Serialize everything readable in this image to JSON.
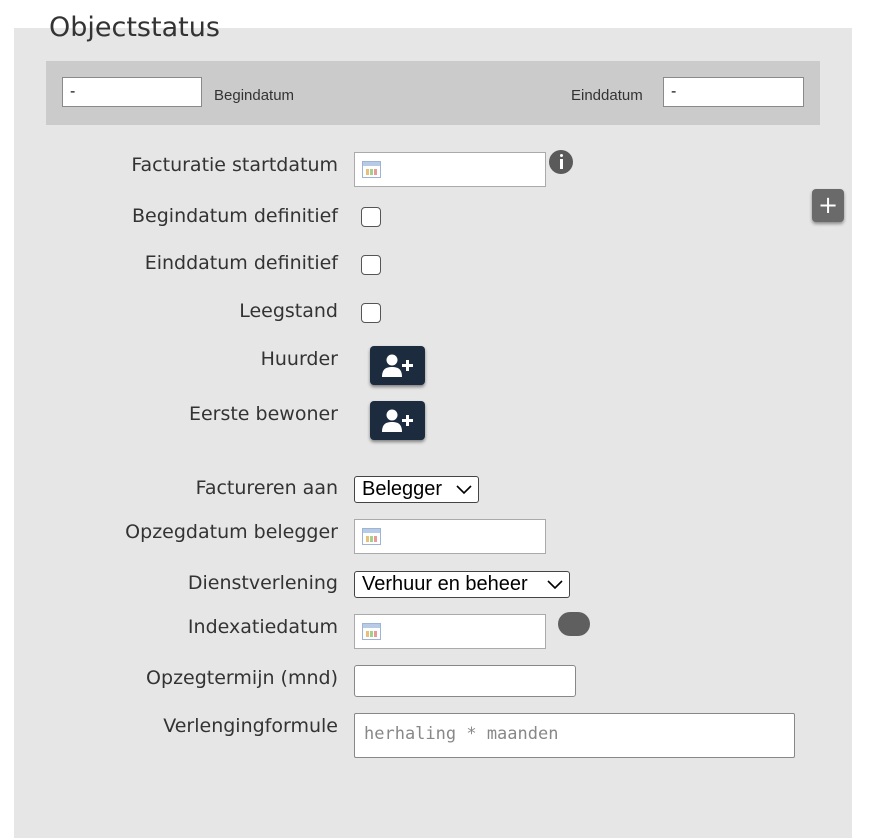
{
  "title": "Objectstatus",
  "daterow": {
    "begin_value": "-",
    "begin_label": "Begindatum",
    "end_label": "Einddatum",
    "end_value": "-"
  },
  "fields": {
    "facturatie_startdatum": "Facturatie startdatum",
    "begindatum_definitief": "Begindatum definitief",
    "einddatum_definitief": "Einddatum definitief",
    "leegstand": "Leegstand",
    "huurder": "Huurder",
    "eerste_bewoner": "Eerste bewoner",
    "factureren_aan": "Factureren aan",
    "opzegdatum_belegger": "Opzegdatum belegger",
    "dienstverlening": "Dienstverlening",
    "indexatiedatum": "Indexatiedatum",
    "opzegtermijn": "Opzegtermijn (mnd)",
    "verlengingformule": "Verlengingformule"
  },
  "selects": {
    "factureren_aan": "Belegger",
    "dienstverlening": "Verhuur en beheer"
  },
  "inputs": {
    "verlenging_placeholder": "herhaling * maanden"
  },
  "icons": {
    "calendar": "calendar-icon",
    "info": "info-icon",
    "add": "plus-icon",
    "add_user": "user-plus-icon",
    "dropdown": "chevron-down-icon"
  }
}
